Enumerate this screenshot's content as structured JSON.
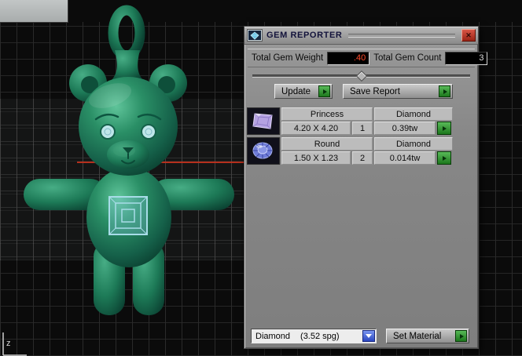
{
  "window": {
    "axis_label": "z"
  },
  "gem_reporter": {
    "title": "GEM REPORTER",
    "icons": {
      "title_icon": "gem-picture-icon",
      "close_icon": "close-icon",
      "go_icon": "green-play-arrow-icon",
      "dropdown_icon": "chevron-down-icon"
    },
    "totals": {
      "weight_label": "Total Gem Weight",
      "weight_value": ".40",
      "count_label": "Total Gem Count",
      "count_value": "3"
    },
    "actions": {
      "update_label": "Update",
      "save_report_label": "Save Report",
      "set_material_label": "Set Material"
    },
    "gem_rows": [
      {
        "icon": "princess-gem-icon",
        "shape": "Princess",
        "dimensions": "4.20 X 4.20",
        "material": "Diamond",
        "count": "1",
        "weight": "0.39tw"
      },
      {
        "icon": "round-gem-icon",
        "shape": "Round",
        "dimensions": "1.50 X 1.23",
        "material": "Diamond",
        "count": "2",
        "weight": "0.014tw"
      }
    ],
    "material_selector": {
      "value": "Diamond",
      "detail": "(3.52 spg)"
    }
  },
  "colors": {
    "accent_green": "#2e8b2e",
    "close_red": "#c0392b",
    "weight_value_color": "#ff4a2a",
    "count_value_color": "#dcdcdc",
    "bear_green": "#1f7e58",
    "belly_gem_blue": "#a8dce8",
    "princess_icon_lavender": "#b5a2e2",
    "round_icon_blue": "#6f7cd8",
    "dropdown_button_blue": "#3a55d0"
  }
}
